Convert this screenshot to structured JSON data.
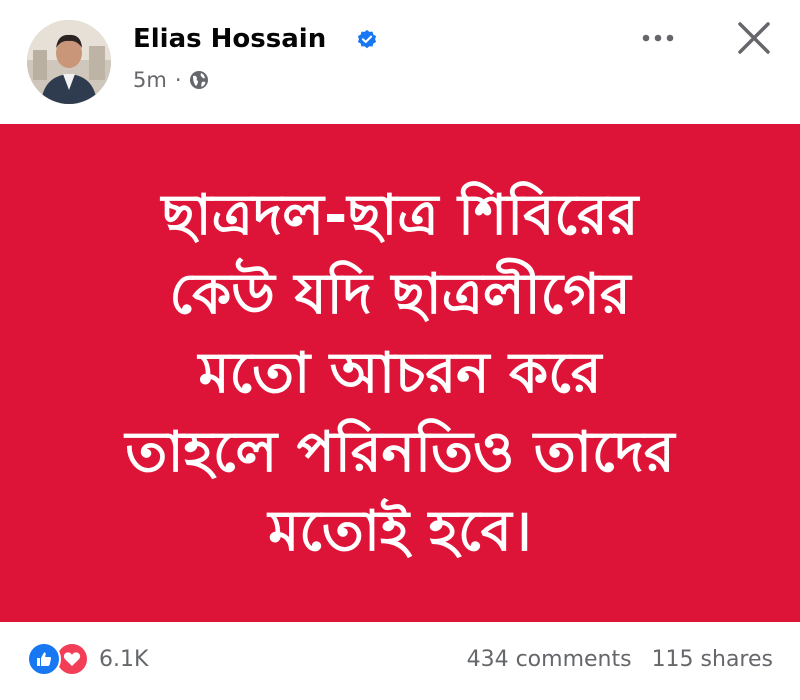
{
  "post": {
    "author": {
      "name": "Elias Hossain",
      "verified": true,
      "avatar_icon": "avatar"
    },
    "time": "5m",
    "separator": "·",
    "privacy_icon": "globe-icon",
    "menu_icon": "more-icon",
    "close_icon": "close-icon",
    "background_color": "#dd1438",
    "text_lines": [
      "ছাত্রদল-ছাত্র শিবিরের",
      "কেউ যদি ছাত্রলীগের",
      "মতো আচরন করে",
      "তাহলে পরিনতিও তাদের",
      "মতোই হবে।"
    ],
    "reactions": {
      "count": "6.1K",
      "icons": [
        "like-icon",
        "love-icon"
      ]
    },
    "comments": "434 comments",
    "shares": "115 shares"
  },
  "colors": {
    "like": "#1877f2",
    "love": "#f33e58",
    "verified": "#1877f2",
    "secondary_text": "#65676b"
  }
}
